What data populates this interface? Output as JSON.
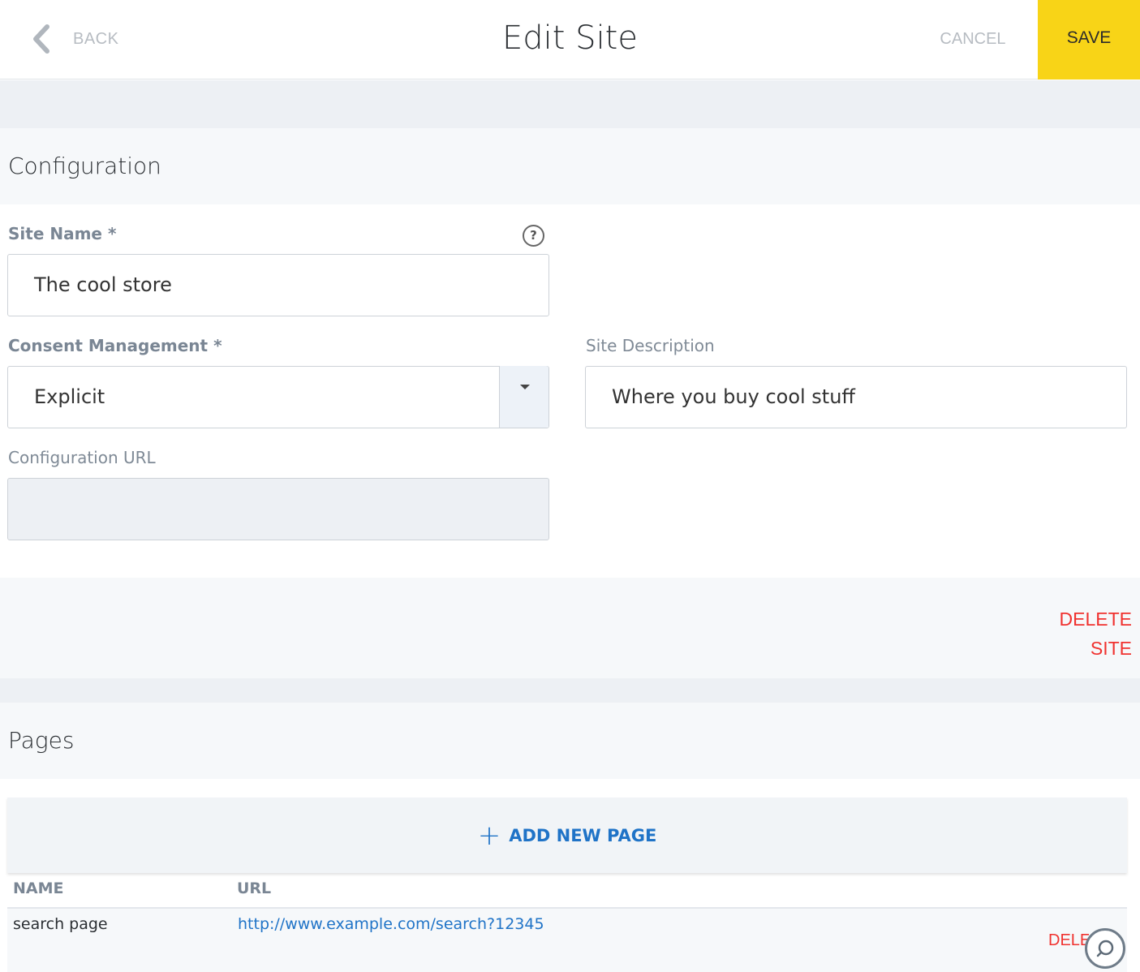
{
  "header": {
    "back_label": "BACK",
    "title": "Edit Site",
    "cancel_label": "CANCEL",
    "save_label": "SAVE"
  },
  "configuration": {
    "section_title": "Configuration",
    "site_name": {
      "label": "Site Name *",
      "value": "The cool store",
      "help_icon": "?"
    },
    "consent_management": {
      "label": "Consent Management *",
      "value": "Explicit"
    },
    "site_description": {
      "label": "Site Description",
      "value": "Where you buy cool stuff"
    },
    "configuration_url": {
      "label": "Configuration URL",
      "value": ""
    },
    "delete_site_label": "DELETE SITE"
  },
  "pages": {
    "section_title": "Pages",
    "add_new_page_label": "ADD NEW PAGE",
    "add_icon": "+",
    "columns": [
      "NAME",
      "URL"
    ],
    "rows": [
      {
        "name": "search page",
        "url": "http://www.example.com/search?12345",
        "delete_label": "DELETE"
      }
    ]
  },
  "colors": {
    "save_bg": "#f8d417",
    "danger": "#f0322f",
    "link": "#1f73c7"
  }
}
